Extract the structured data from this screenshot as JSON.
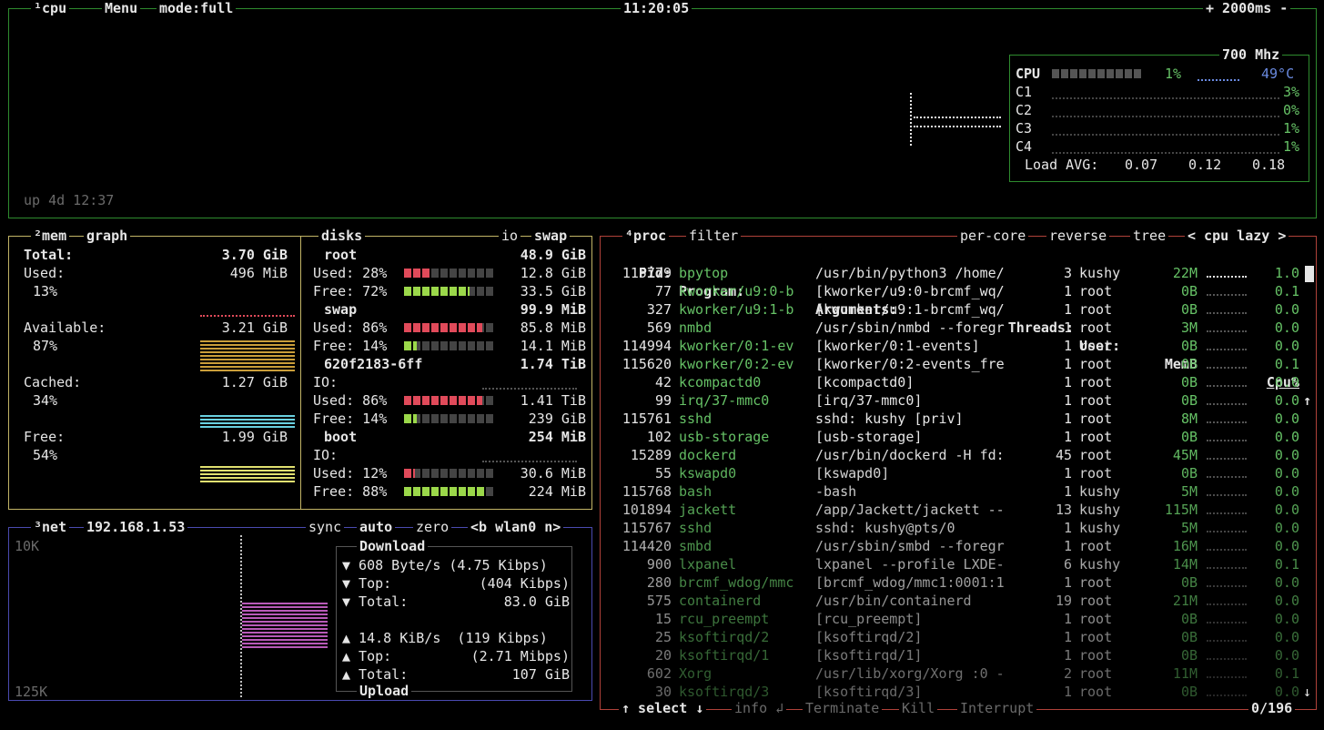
{
  "cpu": {
    "tag_cpu": "¹cpu",
    "tag_menu": "Menu",
    "tag_mode": "mode:full",
    "clock": "11:20:05",
    "tag_speed": "+ 2000ms -",
    "uptime": "up 4d 12:37",
    "freq": "700 Mhz",
    "total_label": "CPU",
    "total_pct": "1%",
    "temp": "49°C",
    "cores": [
      {
        "label": "C1",
        "pct": "3%"
      },
      {
        "label": "C2",
        "pct": "0%"
      },
      {
        "label": "C3",
        "pct": "1%"
      },
      {
        "label": "C4",
        "pct": "1%"
      }
    ],
    "load_label": "Load AVG:",
    "load": [
      "0.07",
      "0.12",
      "0.18"
    ]
  },
  "mem": {
    "tag_mem": "²mem",
    "tag_graph": "graph",
    "total_label": "Total:",
    "total_value": "3.70 GiB",
    "items": [
      {
        "label": "Used:",
        "value": "496 MiB",
        "pct": "13%"
      },
      {
        "label": "Available:",
        "value": "3.21 GiB",
        "pct": "87%"
      },
      {
        "label": "Cached:",
        "value": "1.27 GiB",
        "pct": "34%"
      },
      {
        "label": "Free:",
        "value": "1.99 GiB",
        "pct": "54%"
      }
    ]
  },
  "disks": {
    "tag_disks": "disks",
    "tag_io": "io",
    "tag_swap": "swap",
    "groups": [
      {
        "name": "root",
        "size": "48.9 GiB",
        "lines": [
          {
            "label": "Used: 28%",
            "value": "12.8 GiB",
            "fill": 0.28,
            "kind": "used"
          },
          {
            "label": "Free: 72%",
            "value": "33.5 GiB",
            "fill": 0.72,
            "kind": "free"
          }
        ]
      },
      {
        "name": "swap",
        "size": "99.9 MiB",
        "lines": [
          {
            "label": "Used: 86%",
            "value": "85.8 MiB",
            "fill": 0.86,
            "kind": "used"
          },
          {
            "label": "Free: 14%",
            "value": "14.1 MiB",
            "fill": 0.14,
            "kind": "free"
          }
        ]
      },
      {
        "name": "620f2183-6ff",
        "size": "1.74 TiB",
        "io": "IO:",
        "lines": [
          {
            "label": "Used: 86%",
            "value": "1.41 TiB",
            "fill": 0.86,
            "kind": "used"
          },
          {
            "label": "Free: 14%",
            "value": "239 GiB",
            "fill": 0.14,
            "kind": "free"
          }
        ]
      },
      {
        "name": "boot",
        "size": "254 MiB",
        "io": "IO:",
        "lines": [
          {
            "label": "Used: 12%",
            "value": "30.6 MiB",
            "fill": 0.12,
            "kind": "used"
          },
          {
            "label": "Free: 88%",
            "value": "224 MiB",
            "fill": 0.88,
            "kind": "free"
          }
        ]
      }
    ]
  },
  "net": {
    "tag_net": "³net",
    "ip": "192.168.1.53",
    "tag_sync": "sync",
    "tag_auto": "auto",
    "tag_zero": "zero",
    "tag_iface": "<b wlan0 n>",
    "scale_top": "10K",
    "scale_bottom": "125K",
    "download_label": "Download",
    "upload_label": "Upload",
    "down": {
      "rate": "▼ 608 Byte/s (4.75 Kibps)",
      "top_label": "▼ Top:",
      "top": "(404 Kibps)",
      "total_label": "▼ Total:",
      "total": "83.0 GiB"
    },
    "up": {
      "rate": "▲ 14.8 KiB/s  (119 Kibps)",
      "top_label": "▲ Top:",
      "top": "(2.71 Mibps)",
      "total_label": "▲ Total:",
      "total": "107 GiB"
    }
  },
  "proc": {
    "tag_proc": "⁴proc",
    "tag_filter": "filter",
    "tag_percore": "per-core",
    "tag_reverse": "reverse",
    "tag_tree": "tree",
    "tag_sort": "< cpu lazy >",
    "headers": {
      "pid": "Pid:",
      "program": "Program:",
      "args": "Arguments:",
      "threads": "Threads:",
      "user": "User:",
      "mem": "MemB",
      "cpu": "Cpu%"
    },
    "rows": [
      {
        "pid": "115779",
        "program": "bpytop",
        "args": "/usr/bin/python3 /home/",
        "threads": "3",
        "user": "kushy",
        "mem": "22M",
        "cpu": "1.0"
      },
      {
        "pid": "77",
        "program": "kworker/u9:0-b",
        "args": "[kworker/u9:0-brcmf_wq/",
        "threads": "1",
        "user": "root",
        "mem": "0B",
        "cpu": "0.1"
      },
      {
        "pid": "327",
        "program": "kworker/u9:1-b",
        "args": "[kworker/u9:1-brcmf_wq/",
        "threads": "1",
        "user": "root",
        "mem": "0B",
        "cpu": "0.0"
      },
      {
        "pid": "569",
        "program": "nmbd",
        "args": "/usr/sbin/nmbd --foregr",
        "threads": "1",
        "user": "root",
        "mem": "3M",
        "cpu": "0.0"
      },
      {
        "pid": "114994",
        "program": "kworker/0:1-ev",
        "args": "[kworker/0:1-events]",
        "threads": "1",
        "user": "root",
        "mem": "0B",
        "cpu": "0.0"
      },
      {
        "pid": "115620",
        "program": "kworker/0:2-ev",
        "args": "[kworker/0:2-events_fre",
        "threads": "1",
        "user": "root",
        "mem": "0B",
        "cpu": "0.1"
      },
      {
        "pid": "42",
        "program": "kcompactd0",
        "args": "[kcompactd0]",
        "threads": "1",
        "user": "root",
        "mem": "0B",
        "cpu": "0.0"
      },
      {
        "pid": "99",
        "program": "irq/37-mmc0",
        "args": "[irq/37-mmc0]",
        "threads": "1",
        "user": "root",
        "mem": "0B",
        "cpu": "0.0"
      },
      {
        "pid": "115761",
        "program": "sshd",
        "args": "sshd: kushy [priv]",
        "threads": "1",
        "user": "root",
        "mem": "8M",
        "cpu": "0.0"
      },
      {
        "pid": "102",
        "program": "usb-storage",
        "args": "[usb-storage]",
        "threads": "1",
        "user": "root",
        "mem": "0B",
        "cpu": "0.0"
      },
      {
        "pid": "15289",
        "program": "dockerd",
        "args": "/usr/bin/dockerd -H fd:",
        "threads": "45",
        "user": "root",
        "mem": "45M",
        "cpu": "0.0"
      },
      {
        "pid": "55",
        "program": "kswapd0",
        "args": "[kswapd0]",
        "threads": "1",
        "user": "root",
        "mem": "0B",
        "cpu": "0.0"
      },
      {
        "pid": "115768",
        "program": "bash",
        "args": "-bash",
        "threads": "1",
        "user": "kushy",
        "mem": "5M",
        "cpu": "0.0"
      },
      {
        "pid": "101894",
        "program": "jackett",
        "args": "/app/Jackett/jackett --",
        "threads": "13",
        "user": "kushy",
        "mem": "115M",
        "cpu": "0.0"
      },
      {
        "pid": "115767",
        "program": "sshd",
        "args": "sshd: kushy@pts/0",
        "threads": "1",
        "user": "kushy",
        "mem": "5M",
        "cpu": "0.0"
      },
      {
        "pid": "114420",
        "program": "smbd",
        "args": "/usr/sbin/smbd --foregr",
        "threads": "1",
        "user": "root",
        "mem": "16M",
        "cpu": "0.0"
      },
      {
        "pid": "900",
        "program": "lxpanel",
        "args": "lxpanel --profile LXDE-",
        "threads": "6",
        "user": "kushy",
        "mem": "14M",
        "cpu": "0.1"
      },
      {
        "pid": "280",
        "program": "brcmf_wdog/mmc",
        "args": "[brcmf_wdog/mmc1:0001:1",
        "threads": "1",
        "user": "root",
        "mem": "0B",
        "cpu": "0.0"
      },
      {
        "pid": "575",
        "program": "containerd",
        "args": "/usr/bin/containerd",
        "threads": "19",
        "user": "root",
        "mem": "21M",
        "cpu": "0.0"
      },
      {
        "pid": "15",
        "program": "rcu_preempt",
        "args": "[rcu_preempt]",
        "threads": "1",
        "user": "root",
        "mem": "0B",
        "cpu": "0.0"
      },
      {
        "pid": "25",
        "program": "ksoftirqd/2",
        "args": "[ksoftirqd/2]",
        "threads": "1",
        "user": "root",
        "mem": "0B",
        "cpu": "0.0"
      },
      {
        "pid": "20",
        "program": "ksoftirqd/1",
        "args": "[ksoftirqd/1]",
        "threads": "1",
        "user": "root",
        "mem": "0B",
        "cpu": "0.0"
      },
      {
        "pid": "602",
        "program": "Xorg",
        "args": "/usr/lib/xorg/Xorg :0 -",
        "threads": "2",
        "user": "root",
        "mem": "11M",
        "cpu": "0.1"
      },
      {
        "pid": "30",
        "program": "ksoftirqd/3",
        "args": "[ksoftirqd/3]",
        "threads": "1",
        "user": "root",
        "mem": "0B",
        "cpu": "0.0"
      }
    ],
    "footer": {
      "select": "↑ select ↓",
      "info": "info ↲",
      "terminate": "Terminate",
      "kill": "Kill",
      "interrupt": "Interrupt",
      "count": "0/196"
    }
  },
  "colors": {
    "cpu_border": "#2e8b2e",
    "mem_border": "#c2b466",
    "proc_border": "#b0423a",
    "net_border": "#4a4ab0",
    "accent_green": "#66c266",
    "accent_blue": "#6a8ae0",
    "used_red": "#e04a5a",
    "free_green": "#9bd84a"
  }
}
